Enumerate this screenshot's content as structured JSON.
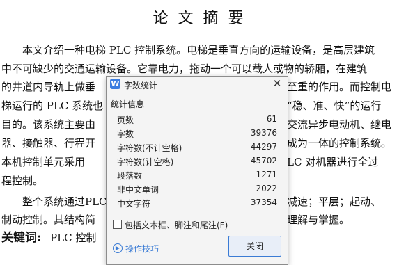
{
  "document": {
    "title": "论文摘要",
    "lines": [
      "　　本文介绍一种电梯 PLC 控制系统。电梯是垂直方向的运输设备，是高层建筑",
      "中不可缺少的交通运输设备。它靠电力，拖动一个可以载人或物的轿厢，在建筑",
      "的井道内导轨上做垂",
      "梯运行的 PLC 系统也",
      "目的。该系统主要由",
      "器、接触器、行程开",
      "本机控制单元采用",
      "程控制。",
      "　　整个系统通过PLC",
      "制动控制。其结构简"
    ],
    "line_tails": [
      "",
      "",
      "至重的作用。而控制电",
      "“稳、准、快”的运行",
      "交流异步电动机、继电",
      "成为一体的控制系统。",
      "LC 对机器进行全过",
      "",
      "减速；平层；起动、",
      "理解与掌握。"
    ],
    "keywords_label": "关键词:",
    "keywords_text": "PLC 控制"
  },
  "dialog": {
    "title": "字数统计",
    "app_icon_letter": "W",
    "close_glyph": "✕",
    "group_label": "统计信息",
    "stats": [
      {
        "label": "页数",
        "value": "61"
      },
      {
        "label": "字数",
        "value": "39376"
      },
      {
        "label": "字符数(不计空格)",
        "value": "44297"
      },
      {
        "label": "字符数(计空格)",
        "value": "45702"
      },
      {
        "label": "段落数",
        "value": "1271"
      },
      {
        "label": "非中文单词",
        "value": "2022"
      },
      {
        "label": "中文字符",
        "value": "37354"
      }
    ],
    "include_option": "包括文本框、脚注和尾注(F)",
    "include_checked": false,
    "tips_label": "操作技巧",
    "close_button": "关闭",
    "accent_color": "#3a7bd5"
  }
}
